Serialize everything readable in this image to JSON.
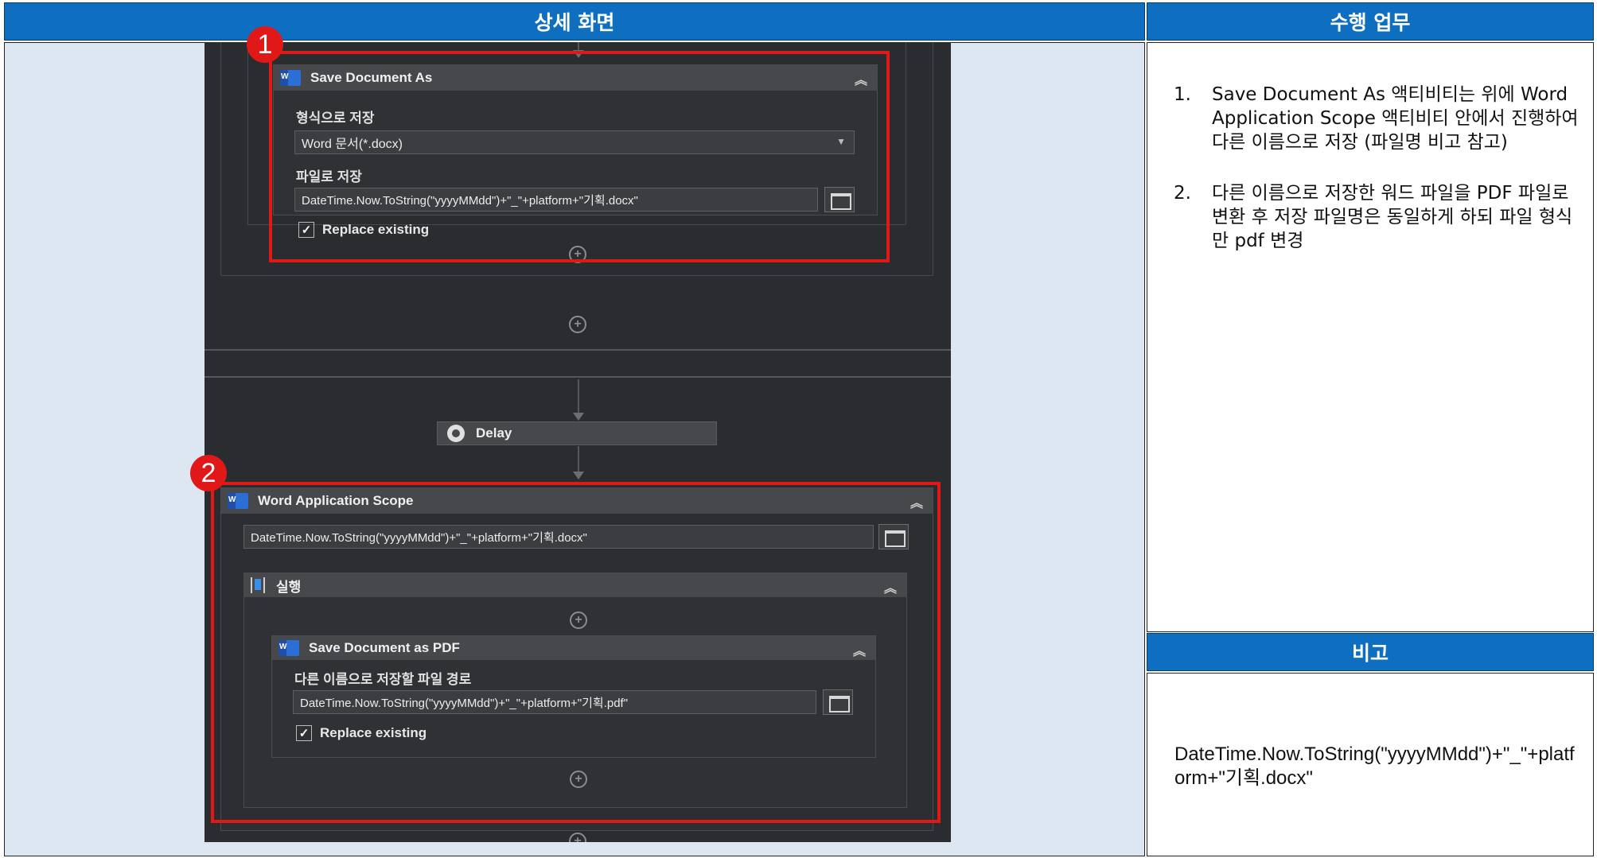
{
  "headers": {
    "detail_screen": "상세 화면",
    "task": "수행 업무",
    "note": "비고"
  },
  "workflow": {
    "save_as": {
      "title": "Save Document As",
      "format_label": "형식으로 저장",
      "format_value": "Word 문서(*.docx)",
      "file_label": "파일로 저장",
      "file_value": "DateTime.Now.ToString(\"yyyyMMdd\")+\"_\"+platform+\"기획.docx\"",
      "replace_label": "Replace existing"
    },
    "delay": {
      "title": "Delay"
    },
    "word_scope": {
      "title": "Word Application Scope",
      "path_value": "DateTime.Now.ToString(\"yyyyMMdd\")+\"_\"+platform+\"기획.docx\""
    },
    "sequence": {
      "title": "실행"
    },
    "save_pdf": {
      "title": "Save Document as PDF",
      "path_label": "다른 이름으로 저장할 파일 경로",
      "path_value": "DateTime.Now.ToString(\"yyyyMMdd\")+\"_\"+platform+\"기획.pdf\"",
      "replace_label": "Replace existing"
    }
  },
  "badges": [
    "1",
    "2"
  ],
  "description": [
    {
      "num": "1.",
      "text": "Save Document As 액티비티는 위에 Word Application Scope 액티비티 안에서 진행하여 다른 이름으로 저장 (파일명 비고 참고)"
    },
    {
      "num": "2.",
      "text": "다른 이름으로 저장한 워드 파일을 PDF 파일로 변환 후 저장 파일명은 동일하게 하되 파일 형식만 pdf 변경"
    }
  ],
  "note_text": "DateTime.Now.ToString(\"yyyyMMdd\")+\"_\"+platform+\"기획.docx\"",
  "colors": {
    "header": "#0e6fc1",
    "left_bg": "#dde7f1",
    "highlight": "#e01818",
    "canvas": "#2a2c2f"
  }
}
